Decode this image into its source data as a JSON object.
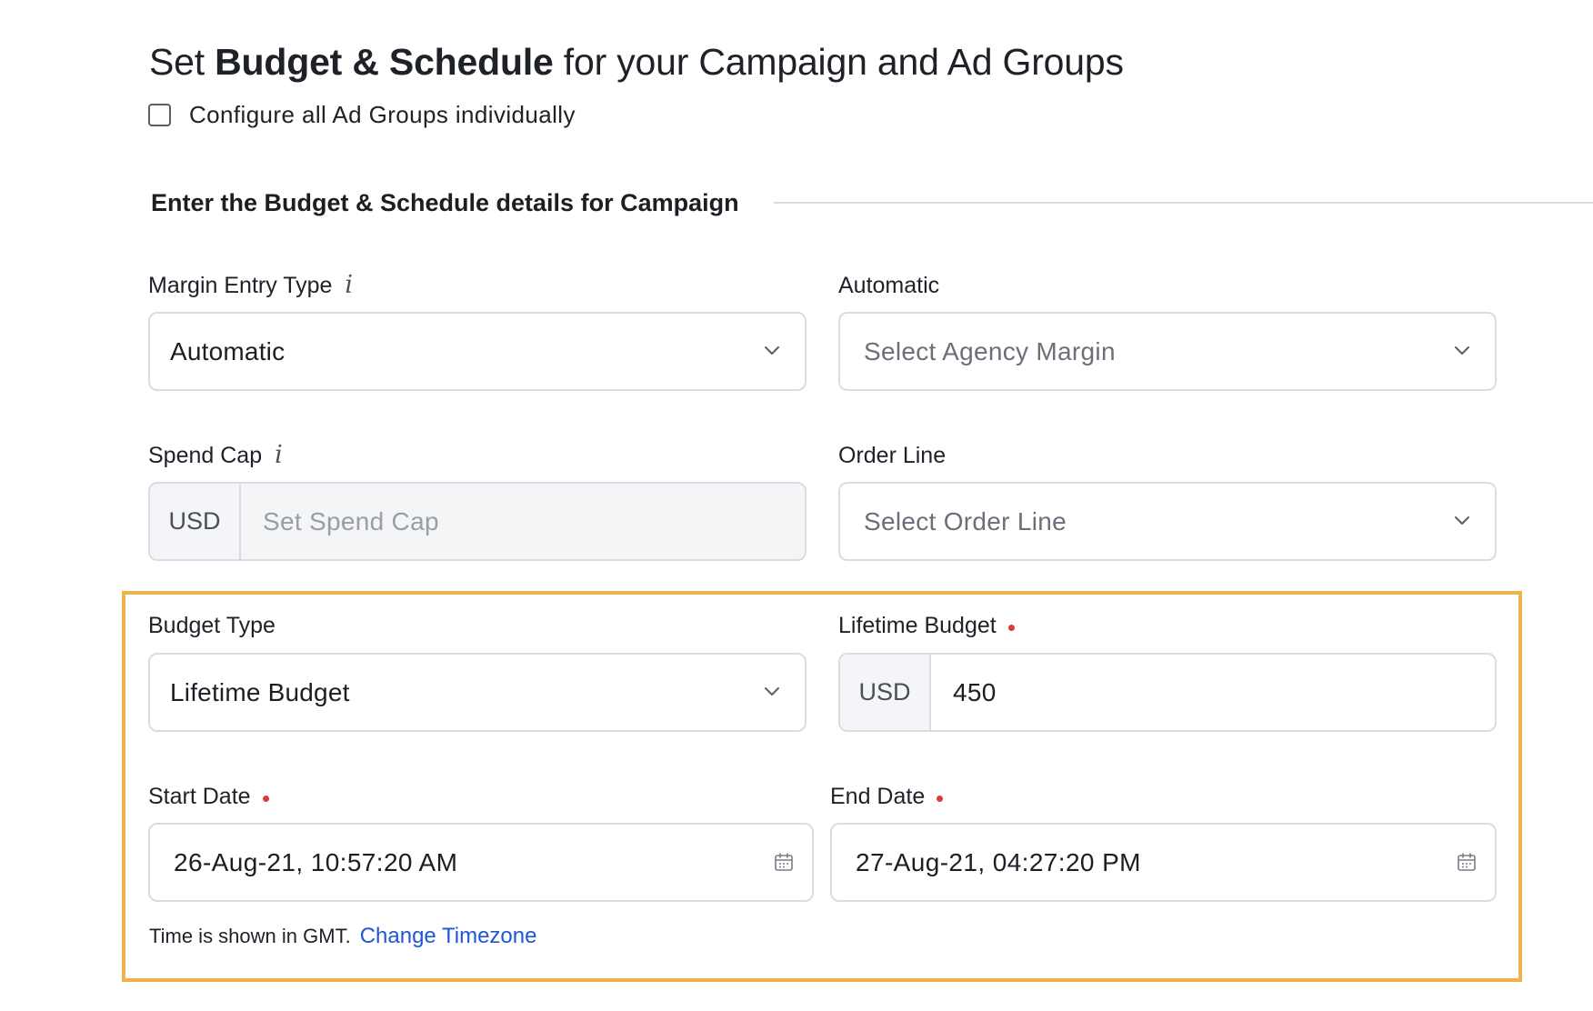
{
  "title": {
    "prefix": "Set ",
    "bold": "Budget & Schedule",
    "suffix": " for your Campaign and Ad Groups"
  },
  "configure_checkbox": {
    "label": "Configure all Ad Groups individually",
    "checked": false
  },
  "section_heading": "Enter the Budget & Schedule details for Campaign",
  "fields": {
    "margin_entry_type": {
      "label": "Margin Entry Type",
      "value": "Automatic",
      "has_info": true
    },
    "automatic": {
      "label": "Automatic",
      "placeholder": "Select Agency Margin"
    },
    "spend_cap": {
      "label": "Spend Cap",
      "currency": "USD",
      "placeholder": "Set Spend Cap",
      "has_info": true,
      "disabled": true
    },
    "order_line": {
      "label": "Order Line",
      "placeholder": "Select Order Line"
    },
    "budget_type": {
      "label": "Budget Type",
      "value": "Lifetime Budget"
    },
    "lifetime_budget": {
      "label": "Lifetime Budget",
      "currency": "USD",
      "value": "450",
      "required": true
    },
    "start_date": {
      "label": "Start Date",
      "value": "26-Aug-21, 10:57:20 AM",
      "required": true
    },
    "end_date": {
      "label": "End Date",
      "value": "27-Aug-21, 04:27:20 PM",
      "required": true
    }
  },
  "timezone": {
    "note": "Time is shown in GMT.",
    "link": "Change Timezone"
  },
  "icons": {
    "info": "info-icon",
    "dropdown": "chevron-down-icon",
    "date": "calendar-icon"
  },
  "colors": {
    "highlight_border": "#f0b34b",
    "link": "#1f56d6",
    "required_dot": "#d93a3a",
    "border": "#dadce2"
  }
}
